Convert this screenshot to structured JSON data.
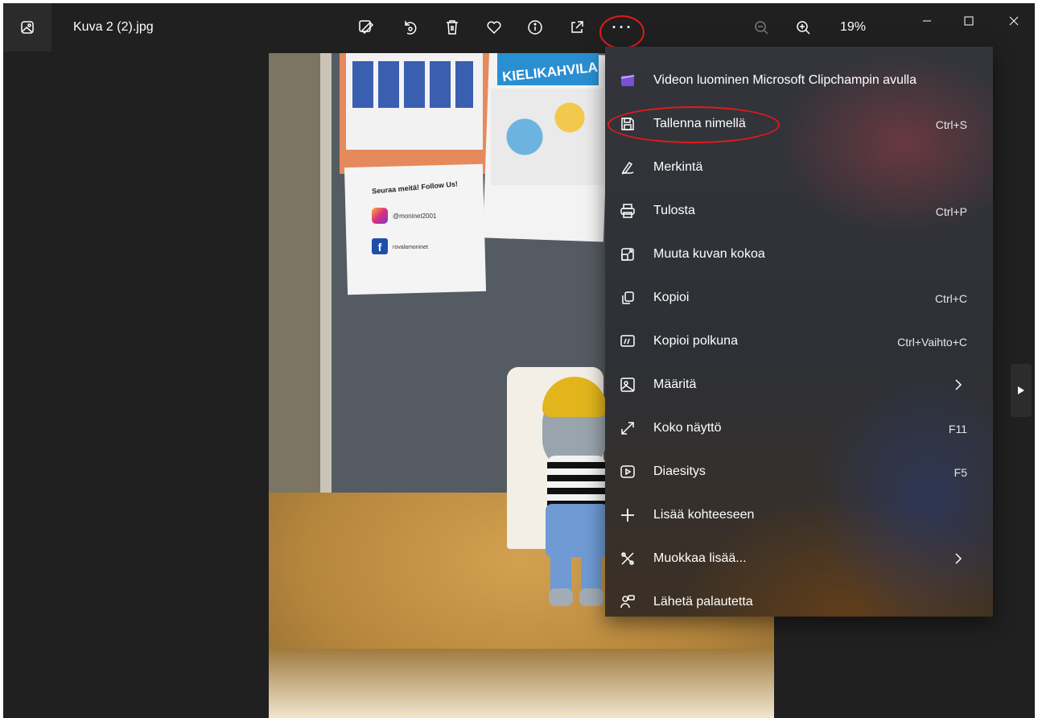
{
  "window": {
    "file_name": "Kuva 2 (2).jpg",
    "zoom_level": "19%"
  },
  "toolbar": {
    "more_label": "···"
  },
  "photo": {
    "follow_text": "Seuraa meitä! Follow Us!",
    "instagram_handle": "@moninet2001",
    "facebook_handle": "rovalamoninet",
    "poster_title": "KIELIKAHVILA"
  },
  "menu": {
    "items": [
      {
        "label": "Videon luominen Microsoft Clipchampin avulla",
        "shortcut": "",
        "icon": "clipchamp-icon"
      },
      {
        "label": "Tallenna nimellä",
        "shortcut": "Ctrl+S",
        "icon": "save-icon"
      },
      {
        "label": "Merkintä",
        "shortcut": "",
        "icon": "markup-icon"
      },
      {
        "label": "Tulosta",
        "shortcut": "Ctrl+P",
        "icon": "print-icon"
      },
      {
        "label": "Muuta kuvan kokoa",
        "shortcut": "",
        "icon": "resize-icon"
      },
      {
        "label": "Kopioi",
        "shortcut": "Ctrl+C",
        "icon": "copy-icon"
      },
      {
        "label": "Kopioi polkuna",
        "shortcut": "Ctrl+Vaihto+C",
        "icon": "copy-path-icon"
      },
      {
        "label": "Määritä",
        "shortcut": "",
        "icon": "set-as-icon"
      },
      {
        "label": "Koko näyttö",
        "shortcut": "F11",
        "icon": "fullscreen-icon"
      },
      {
        "label": "Diaesitys",
        "shortcut": "F5",
        "icon": "slideshow-icon"
      },
      {
        "label": "Lisää kohteeseen",
        "shortcut": "",
        "icon": "add-icon"
      },
      {
        "label": "Muokkaa lisää...",
        "shortcut": "",
        "icon": "edit-more-icon"
      },
      {
        "label": "Lähetä palautetta",
        "shortcut": "",
        "icon": "feedback-icon"
      }
    ]
  },
  "colors": {
    "window_bg": "#202020",
    "highlight_ring": "#e31a1a",
    "clipchamp_purple": "#7b4fd6"
  }
}
